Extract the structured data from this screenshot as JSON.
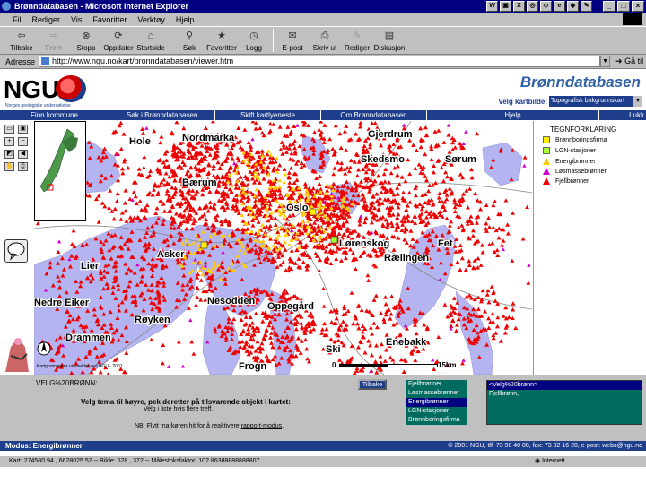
{
  "window": {
    "title": "Brønndatabasen - Microsoft Internet Explorer"
  },
  "menu": {
    "items": [
      "Fil",
      "Rediger",
      "Vis",
      "Favoritter",
      "Verktøy",
      "Hjelp"
    ]
  },
  "toolbar": {
    "buttons": [
      {
        "label": "Tilbake",
        "icon": "back-arrow-icon",
        "enabled": true
      },
      {
        "label": "Frem",
        "icon": "forward-arrow-icon",
        "enabled": false
      },
      {
        "label": "Stopp",
        "icon": "stop-icon",
        "enabled": true
      },
      {
        "label": "Oppdater",
        "icon": "refresh-icon",
        "enabled": true
      },
      {
        "label": "Startside",
        "icon": "home-icon",
        "enabled": true
      },
      {
        "label": "Søk",
        "icon": "search-icon",
        "enabled": true
      },
      {
        "label": "Favoritter",
        "icon": "favorites-icon",
        "enabled": true
      },
      {
        "label": "Logg",
        "icon": "history-icon",
        "enabled": true
      },
      {
        "label": "E-post",
        "icon": "mail-icon",
        "enabled": true
      },
      {
        "label": "Skriv ut",
        "icon": "print-icon",
        "enabled": true
      },
      {
        "label": "Rediger",
        "icon": "edit-icon",
        "enabled": true
      },
      {
        "label": "Diskusjon",
        "icon": "discussion-icon",
        "enabled": true
      }
    ]
  },
  "address": {
    "label": "Adresse",
    "url": "http://www.ngu.no/kart/bronndatabasen/viewer.htm",
    "go_label": "Gå til"
  },
  "header": {
    "logo_text": "NGU",
    "logo_subtitle": "Norges geologiske undersøkelse",
    "app_title": "Brønndatabasen",
    "basemap_label": "Velg kartbilde:",
    "basemap_value": "Topografisk bakgrunnskart"
  },
  "nav": {
    "items": [
      "Finn kommune",
      "Søk i Brønndatabasen",
      "Skift kartlyeneste",
      "Om Brønndatabasen",
      "Hjelp",
      "Lukk"
    ]
  },
  "map": {
    "places": [
      "Hole",
      "Nordmarka",
      "Gjerdrum",
      "Skedsmo",
      "Sørum",
      "Bærum",
      "Oslo",
      "Lørenskog",
      "Fet",
      "Rælingen",
      "Asker",
      "Lier",
      "Nedre Eiker",
      "Nesodden",
      "Oppegård",
      "Røyken",
      "Drammen",
      "Ski",
      "Enebakk",
      "Frogn"
    ],
    "scale_start": "0",
    "scale_end": "15km",
    "credit": "Kartgrunnlag er utarbeidet ved NGU - 2001",
    "colors": {
      "water": "#b4b4f0",
      "fjellbronn": "#ee0000",
      "energibronn": "#ffcc00",
      "losmasse": "#cc00cc",
      "lgn": "#aaff33",
      "bronnboring": "#ffee00"
    }
  },
  "legend": {
    "title": "TEGNFORKLARING",
    "items": [
      {
        "label": "Brønnboringsfirma",
        "shape": "square",
        "color": "#ffee00"
      },
      {
        "label": "LGN-stasjoner",
        "shape": "square",
        "color": "#aaff33"
      },
      {
        "label": "Energibrønner",
        "shape": "triangle",
        "color": "#ffcc00"
      },
      {
        "label": "Løsmassebrønner",
        "shape": "triangle",
        "color": "#cc00cc"
      },
      {
        "label": "Fjellbrønner",
        "shape": "triangle",
        "color": "#ee0000"
      }
    ]
  },
  "lower": {
    "title": "VELG%20BRØNN:",
    "instruction": "Velg tema til høyre, pek deretter på tilsvarende objekt i kartet:",
    "sub": "Velg i liste hvis flere treff.",
    "nb_prefix": "NB: Flytt markøren hit for å reaktivere ",
    "nb_link": "rapport-modus",
    "nb_suffix": ".",
    "back_label": "Tilbake",
    "themes": [
      "Fjellbrønner",
      "Løsmassebrønner",
      "Energibrønner",
      "LGN-stasjoner",
      "Brønnboringsfirma"
    ],
    "selected_theme": "Energibrønner",
    "results": [
      "<Velg%20brønn>",
      "Fjellbrønn,"
    ]
  },
  "status": {
    "modus": "Modus: Energibrønner",
    "contact": "© 2001 NGU, tlf: 73 90 40 00, fax: 73 92 16 20, e-post: webs@ngu.no",
    "coords": "Kart: 274580.94 , 6628025.52 -- Bilde: 528 , 372 -- Målestoksfaktor: 102.86388888888807",
    "zone": "Internett"
  }
}
